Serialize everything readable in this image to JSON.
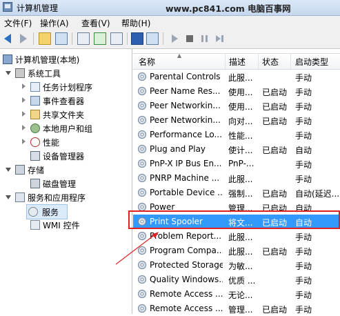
{
  "window": {
    "title": "计算机管理",
    "watermark": "www.pc841.com 电脑百事网"
  },
  "menu": [
    "文件(F)",
    "操作(A)",
    "查看(V)",
    "帮助(H)"
  ],
  "toolbar": {
    "buttons": [
      "back-icon",
      "forward-icon",
      "up-folder-icon",
      "show-tree-icon",
      "properties-icon",
      "refresh-icon",
      "export-icon",
      "help-icon",
      "view-icon",
      "start-icon",
      "stop-icon",
      "pause-icon",
      "restart-icon"
    ]
  },
  "tree": {
    "items": [
      {
        "label": "计算机管理(本地)"
      },
      {
        "label": "系统工具"
      },
      {
        "label": "任务计划程序"
      },
      {
        "label": "事件查看器"
      },
      {
        "label": "共享文件夹"
      },
      {
        "label": "本地用户和组"
      },
      {
        "label": "性能"
      },
      {
        "label": "设备管理器"
      },
      {
        "label": "存储"
      },
      {
        "label": "磁盘管理"
      },
      {
        "label": "服务和应用程序"
      },
      {
        "label": "服务"
      },
      {
        "label": "WMI 控件"
      }
    ],
    "selected": "服务"
  },
  "list": {
    "columns": [
      "名称",
      "描述",
      "状态",
      "启动类型"
    ],
    "rows": [
      {
        "name": "Parental Controls",
        "desc": "此服...",
        "status": "",
        "startup": "手动"
      },
      {
        "name": "Peer Name Res...",
        "desc": "使用...",
        "status": "已启动",
        "startup": "手动"
      },
      {
        "name": "Peer Networkin...",
        "desc": "使用...",
        "status": "已启动",
        "startup": "手动"
      },
      {
        "name": "Peer Networkin...",
        "desc": "向对...",
        "status": "已启动",
        "startup": "手动"
      },
      {
        "name": "Performance Lo...",
        "desc": "性能...",
        "status": "",
        "startup": "手动"
      },
      {
        "name": "Plug and Play",
        "desc": "使计...",
        "status": "已启动",
        "startup": "自动"
      },
      {
        "name": "PnP-X IP Bus En...",
        "desc": "PnP-...",
        "status": "",
        "startup": "手动"
      },
      {
        "name": "PNRP Machine ...",
        "desc": "此服...",
        "status": "",
        "startup": "手动"
      },
      {
        "name": "Portable Device ...",
        "desc": "强制...",
        "status": "已启动",
        "startup": "自动(延迟..."
      },
      {
        "name": "Power",
        "desc": "管理...",
        "status": "已启动",
        "startup": "自动"
      },
      {
        "name": "Print Spooler",
        "desc": "将文...",
        "status": "已启动",
        "startup": "自动"
      },
      {
        "name": "Problem Report...",
        "desc": "此服...",
        "status": "",
        "startup": "手动"
      },
      {
        "name": "Program Compa...",
        "desc": "此服...",
        "status": "已启动",
        "startup": "手动"
      },
      {
        "name": "Protected Storage",
        "desc": "为敏...",
        "status": "",
        "startup": "手动"
      },
      {
        "name": "Quality Windows...",
        "desc": "优质 ...",
        "status": "",
        "startup": "手动"
      },
      {
        "name": "Remote Access ...",
        "desc": "无论...",
        "status": "",
        "startup": "手动"
      },
      {
        "name": "Remote Access ...",
        "desc": "管理...",
        "status": "已启动",
        "startup": "手动"
      }
    ],
    "selected_row": "Print Spooler"
  },
  "colors": {
    "selection": "#3399ff",
    "highlight": "#e02020"
  }
}
